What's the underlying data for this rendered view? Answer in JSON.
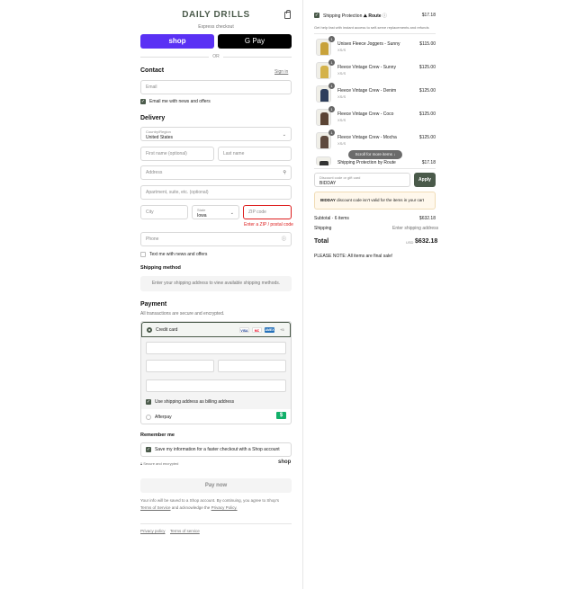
{
  "brand": {
    "logo_text": "DAILY DR!LLS",
    "accent": "#4a5a4a",
    "shop_pay_color": "#5a31f4",
    "error_color": "#dd1d1d"
  },
  "express": {
    "label": "Express checkout",
    "shop_label": "shop",
    "gpay_label": "G Pay",
    "or_label": "OR"
  },
  "contact": {
    "title": "Contact",
    "signin_label": "Sign in",
    "email_placeholder": "Email",
    "newsletter_label": "Email me with news and offers",
    "newsletter_checked": true
  },
  "delivery": {
    "title": "Delivery",
    "country_label": "Country/Region",
    "country_value": "United States",
    "first_name_placeholder": "First name (optional)",
    "last_name_placeholder": "Last name",
    "address_placeholder": "Address",
    "apartment_placeholder": "Apartment, suite, etc. (optional)",
    "city_placeholder": "City",
    "state_label": "State",
    "state_value": "Iowa",
    "zip_placeholder": "ZIP code",
    "zip_error": "Enter a ZIP / postal code",
    "phone_placeholder": "Phone",
    "text_label": "Text me with news and offers",
    "text_checked": false
  },
  "shipping_method": {
    "title": "Shipping method",
    "message": "Enter your shipping address to view available shipping methods."
  },
  "payment": {
    "title": "Payment",
    "subtitle": "All transactions are secure and encrypted.",
    "credit_card_label": "Credit card",
    "card_logos": [
      "VISA",
      "MC",
      "AMEX"
    ],
    "more_label": "+5",
    "billing_label": "Use shipping address as billing address",
    "billing_checked": true,
    "afterpay_label": "Afterpay",
    "afterpay_icon": "$"
  },
  "remember": {
    "title": "Remember me",
    "save_label": "Save my information for a faster checkout with a Shop account",
    "secure_label": "Secure and encrypted",
    "shop_label": "shop"
  },
  "pay_now_label": "Pay now",
  "legal": {
    "line1": "Your info will be saved to a Shop account. By continuing, you agree to Shop's",
    "tos_label": "Terms of Service",
    "and_text": "and acknowledge the",
    "privacy_label": "Privacy Policy."
  },
  "footer": {
    "privacy_label": "Privacy policy",
    "terms_label": "Terms of service"
  },
  "summary": {
    "protection_label": "Shipping Protection",
    "route_label": "Route",
    "protection_price": "$17.18",
    "protection_desc": "Get help fast with instant access to self-serve replacements and refunds",
    "items": [
      {
        "name": "Unisex Fleece Joggers - Sunny",
        "size": "XS/S",
        "price": "$115.00",
        "qty": "1",
        "color": "#c8a23a"
      },
      {
        "name": "Fleece Vintage Crew - Sunny",
        "size": "XS/S",
        "price": "$125.00",
        "qty": "1",
        "color": "#d4b24a"
      },
      {
        "name": "Fleece Vintage Crew - Denim",
        "size": "XS/S",
        "price": "$125.00",
        "qty": "1",
        "color": "#2e3e5c"
      },
      {
        "name": "Fleece Vintage Crew - Coco",
        "size": "XS/S",
        "price": "$125.00",
        "qty": "1",
        "color": "#5b4434"
      },
      {
        "name": "Fleece Vintage Crew - Mocha",
        "size": "XS/S",
        "price": "$125.00",
        "qty": "1",
        "color": "#5e4a3e"
      }
    ],
    "last_item_name": "Shipping Protection by Route",
    "last_item_price": "$17.18",
    "scroll_label": "Scroll for more items ↓",
    "discount_label": "Discount code or gift card",
    "discount_value": "BIDDAY",
    "apply_label": "Apply",
    "notice_code": "BIDDAY",
    "notice_text": "discount code isn't valid for the items in your cart",
    "subtotal_label": "Subtotal · 6 items",
    "subtotal_value": "$632.18",
    "shipping_label": "Shipping",
    "shipping_value": "Enter shipping address",
    "total_label": "Total",
    "currency": "USD",
    "total_value": "$632.18",
    "note": "PLEASE NOTE: All items are final sale!"
  }
}
